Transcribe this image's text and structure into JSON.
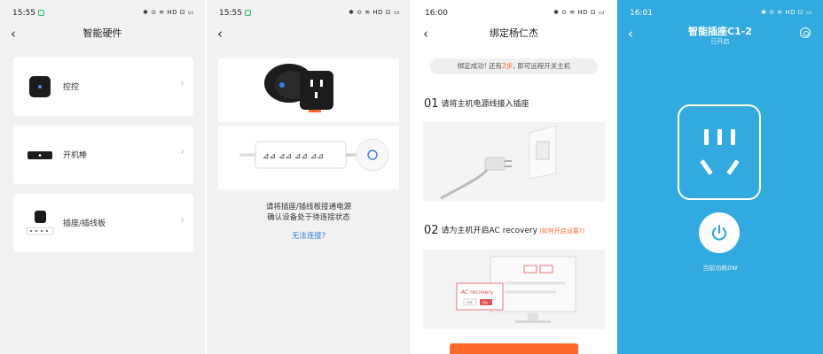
{
  "screens": [
    {
      "time": "15:55",
      "status_icons": "✱ ⊙ ≋ HD ⊡ ▭",
      "title": "智能硬件",
      "items": [
        {
          "label": "控控"
        },
        {
          "label": "开机棒"
        },
        {
          "label": "插座/插线板"
        }
      ]
    },
    {
      "time": "15:55",
      "status_icons": "✱ ⊙ ≋ HD ⊡ ▭",
      "instruction_line1": "请将插座/插线板接通电源",
      "instruction_line2": "确认设备处于待连接状态",
      "link": "无法连接?"
    },
    {
      "time": "16:00",
      "status_icons": "✱ ⊙ ≋ HD ⊡ ▭",
      "title": "绑定杨仁杰",
      "notice_pre": "绑定成功! 还有",
      "notice_highlight": "2步",
      "notice_post": ", 即可远程开关主机",
      "step1_num": "01",
      "step1_text": "请将主机电源线接入插座",
      "step2_num": "02",
      "step2_text": "请为主机开启AC recovery",
      "step2_note": "(如何开启设置?)",
      "bios_title": "AC recovery",
      "bios_off": "Off",
      "bios_on": "On"
    },
    {
      "time": "16:01",
      "status_icons": "✱ ⊙ ≋ HD ⊡ ▭",
      "title": "智能插座C1-2",
      "subtitle": "已开启",
      "power_caption": "当前功耗0W"
    }
  ],
  "colors": {
    "accent_orange": "#ff6a2b",
    "link_blue": "#2a7fd4",
    "control_blue": "#33aadf"
  }
}
